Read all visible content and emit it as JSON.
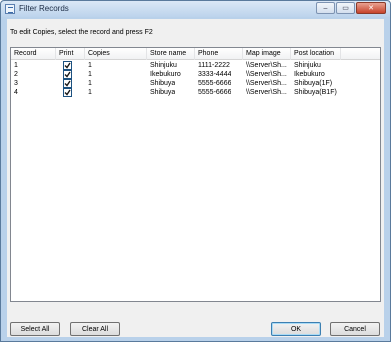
{
  "window": {
    "title": "Filter Records",
    "controls": {
      "minimize": "–",
      "maximize": "▭",
      "close": "✕"
    }
  },
  "instruction": "To edit Copies, select the record and press F2",
  "table": {
    "columns": [
      "Record",
      "Print",
      "Copies",
      "Store name",
      "Phone",
      "Map image",
      "Post location"
    ],
    "rows": [
      {
        "record": "1",
        "print": true,
        "copies": "1",
        "store_name": "Shinjuku",
        "phone": "1111-2222",
        "map_image": "\\\\Server\\Sh...",
        "post_location": "Shinjuku"
      },
      {
        "record": "2",
        "print": true,
        "copies": "1",
        "store_name": "Ikebukuro",
        "phone": "3333-4444",
        "map_image": "\\\\Server\\Sh...",
        "post_location": "Ikebukuro"
      },
      {
        "record": "3",
        "print": true,
        "copies": "1",
        "store_name": "Shibuya",
        "phone": "5555-6666",
        "map_image": "\\\\Server\\Sh...",
        "post_location": "Shibuya(1F)"
      },
      {
        "record": "4",
        "print": true,
        "copies": "1",
        "store_name": "Shibuya",
        "phone": "5555-6666",
        "map_image": "\\\\Server\\Sh...",
        "post_location": "Shibuya(B1F)"
      }
    ]
  },
  "buttons": {
    "select_all": "Select All",
    "clear_all": "Clear All",
    "ok": "OK",
    "cancel": "Cancel"
  }
}
